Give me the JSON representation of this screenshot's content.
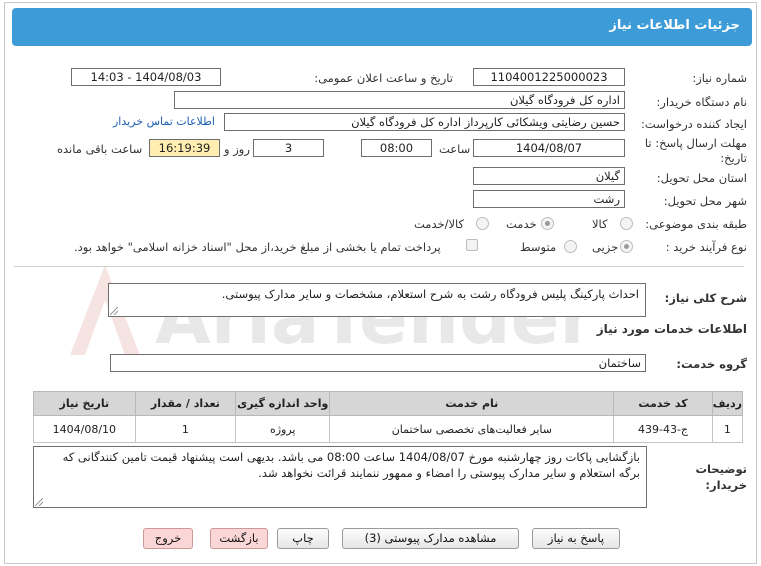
{
  "header": {
    "title": "جزئیات اطلاعات نیاز"
  },
  "form": {
    "need_number_label": "شماره نیاز:",
    "need_number": "1104001225000023",
    "announce_label": "تاریخ و ساعت اعلان عمومی:",
    "announce_value": "1404/08/03 - 14:03",
    "buyer_org_label": "نام دستگاه خریدار:",
    "buyer_org": "اداره کل فرودگاه گیلان",
    "creator_label": "ایجاد کننده درخواست:",
    "creator": "حسین رضایتی ویشکائی کارپرداز اداره کل فرودگاه گیلان",
    "contact_link": "اطلاعات تماس خریدار",
    "deadline_label_1": "مهلت ارسال پاسخ: تا",
    "deadline_label_2": "تاریخ:",
    "deadline_date": "1404/08/07",
    "time_label": "ساعت",
    "deadline_time": "08:00",
    "days_value": "3",
    "days_label": "روز و",
    "remaining_time": "16:19:39",
    "remaining_label": "ساعت باقی مانده",
    "province_label": "استان محل تحویل:",
    "province": "گیلان",
    "city_label": "شهر محل تحویل:",
    "city": "رشت",
    "category_label": "طبقه بندی موضوعی:",
    "category_options": [
      "کالا",
      "خدمت",
      "کالا/خدمت"
    ],
    "category_selected": "خدمت",
    "process_label": "نوع فرآیند خرید :",
    "process_options": [
      "جزیی",
      "متوسط"
    ],
    "process_selected": "جزیی",
    "payment_note": "پرداخت تمام یا بخشی از مبلغ خرید،از محل \"اسناد خزانه اسلامی\" خواهد بود."
  },
  "summary": {
    "label": "شرح کلی نیاز:",
    "text": "احداث پارکینگ پلیس فرودگاه رشت به شرح استعلام، مشخصات و سایر مدارک پیوستی."
  },
  "services_section": {
    "title": "اطلاعات خدمات مورد نیاز",
    "group_label": "گروه خدمت:",
    "group_value": "ساختمان"
  },
  "table": {
    "columns": [
      "ردیف",
      "کد خدمت",
      "نام خدمت",
      "واحد اندازه گیری",
      "تعداد / مقدار",
      "تاریخ نیاز"
    ],
    "rows": [
      [
        "1",
        "ج-43-439",
        "سایر فعالیت‌های تخصصی ساختمان",
        "پروژه",
        "1",
        "1404/08/10"
      ]
    ]
  },
  "notes": {
    "label_1": "توضیحات",
    "label_2": "خریدار:",
    "text": "بازگشایی پاکات روز چهارشنبه مورخ 1404/08/07 ساعت 08:00  می باشد. بدیهی است پیشنهاد قیمت تامین کنندگانی که برگه استعلام و سایر مدارک پیوستی را امضاء و ممهور ننمایند قرائت نخواهد شد."
  },
  "buttons": {
    "reply": "پاسخ به نیاز",
    "attachments": "مشاهده مدارک پیوستی (3)",
    "print": "چاپ",
    "back": "بازگشت",
    "exit": "خروج"
  },
  "watermark": {
    "text": "AriaTender.neT"
  },
  "colors": {
    "header": "#3d9bd8",
    "highlight": "#ffeeb0",
    "link": "#1a5fb4",
    "danger_button": "#fbd6d6"
  }
}
